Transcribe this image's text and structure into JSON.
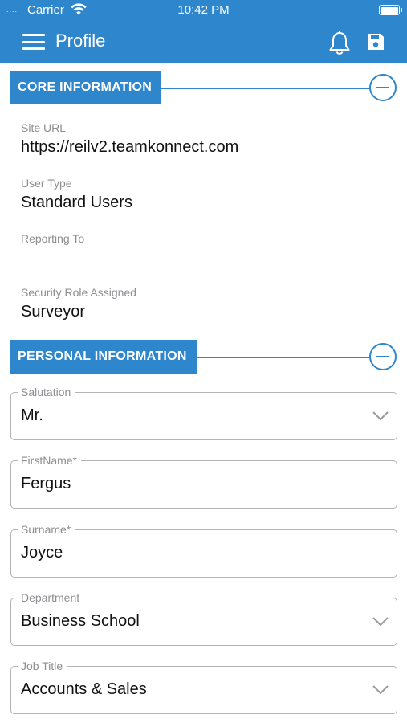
{
  "status_bar": {
    "signal": "....",
    "carrier": "Carrier",
    "time": "10:42 PM",
    "battery_level": 1.0
  },
  "header": {
    "title": "Profile",
    "icons": [
      "menu-icon",
      "bell-icon",
      "save-icon"
    ]
  },
  "colors": {
    "primary": "#2e86cd",
    "label_gray": "#8e8e93",
    "border_gray": "#b3b3b3"
  },
  "core_section": {
    "title": "CORE INFORMATION",
    "fields": [
      {
        "label": "Site URL",
        "value": "https://reilv2.teamkonnect.com"
      },
      {
        "label": "User Type",
        "value": "Standard Users"
      },
      {
        "label": "Reporting To",
        "value": ""
      },
      {
        "label": "Security Role Assigned",
        "value": "Surveyor"
      }
    ]
  },
  "personal_section": {
    "title": "PERSONAL INFORMATION",
    "fields": [
      {
        "label": "Salutation",
        "value": "Mr.",
        "dropdown": true
      },
      {
        "label": "FirstName*",
        "value": "Fergus",
        "dropdown": false
      },
      {
        "label": "Surname*",
        "value": "Joyce",
        "dropdown": false
      },
      {
        "label": "Department",
        "value": "Business School",
        "dropdown": true
      },
      {
        "label": "Job Title",
        "value": "Accounts & Sales",
        "dropdown": true
      }
    ]
  }
}
